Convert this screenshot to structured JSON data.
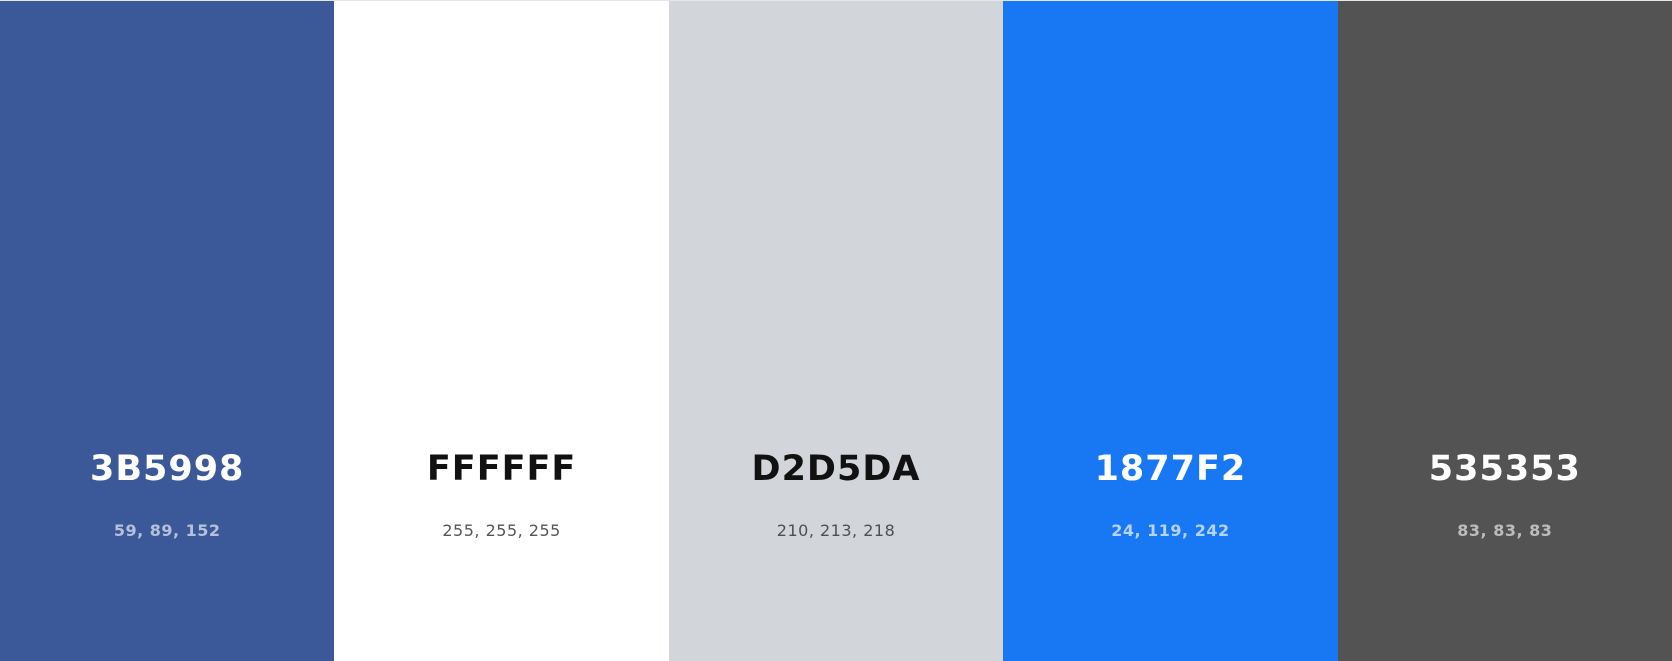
{
  "swatches": [
    {
      "hex": "3B5998",
      "rgb": "59, 89, 152",
      "color": "#3B5998",
      "text_color": "#ffffff",
      "sub_color": "#b5c0da"
    },
    {
      "hex": "FFFFFF",
      "rgb": "255, 255, 255",
      "color": "#FFFFFF",
      "text_color": "#111111",
      "sub_color": "#555555"
    },
    {
      "hex": "D2D5DA",
      "rgb": "210, 213, 218",
      "color": "#D2D5DA",
      "text_color": "#111111",
      "sub_color": "#4d4f53"
    },
    {
      "hex": "1877F2",
      "rgb": "24, 119, 242",
      "color": "#1877F2",
      "text_color": "#ffffff",
      "sub_color": "#b7d3fb"
    },
    {
      "hex": "535353",
      "rgb": "83, 83, 83",
      "color": "#535353",
      "text_color": "#ffffff",
      "sub_color": "#bcbcbc"
    }
  ]
}
